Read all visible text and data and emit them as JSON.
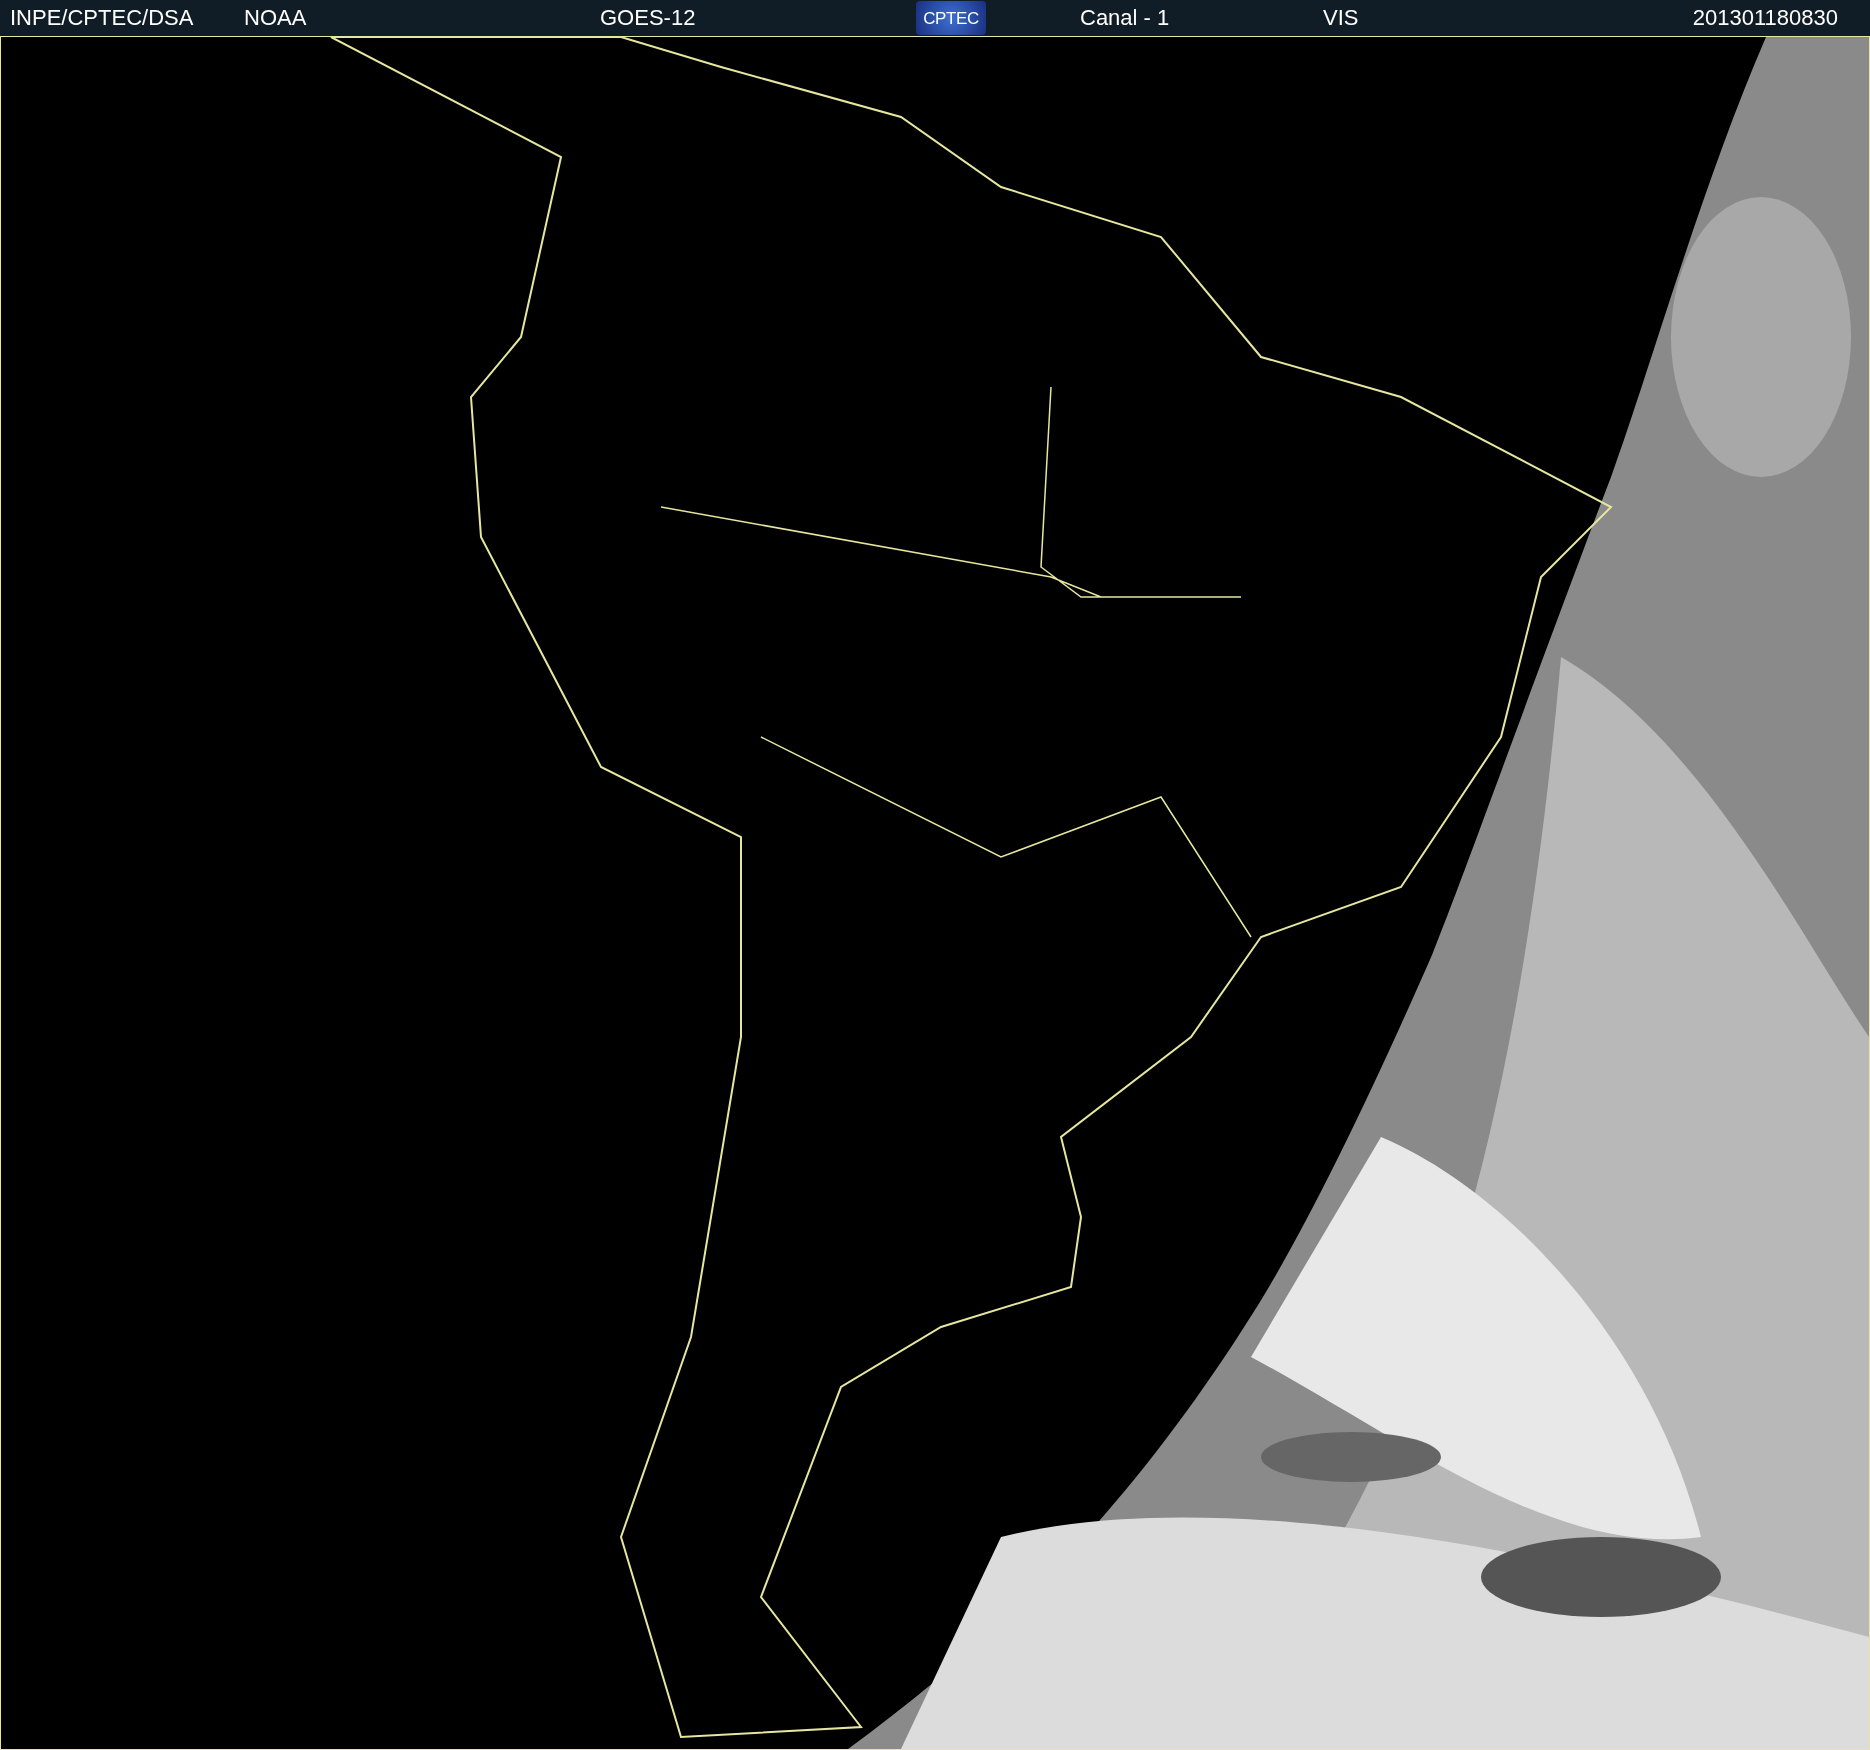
{
  "header": {
    "agency": "INPE/CPTEC/DSA",
    "source": "NOAA",
    "satellite": "GOES-12",
    "logo": "CPTEC",
    "channel": "Canal - 1",
    "band": "VIS",
    "timestamp": "201301180830"
  }
}
